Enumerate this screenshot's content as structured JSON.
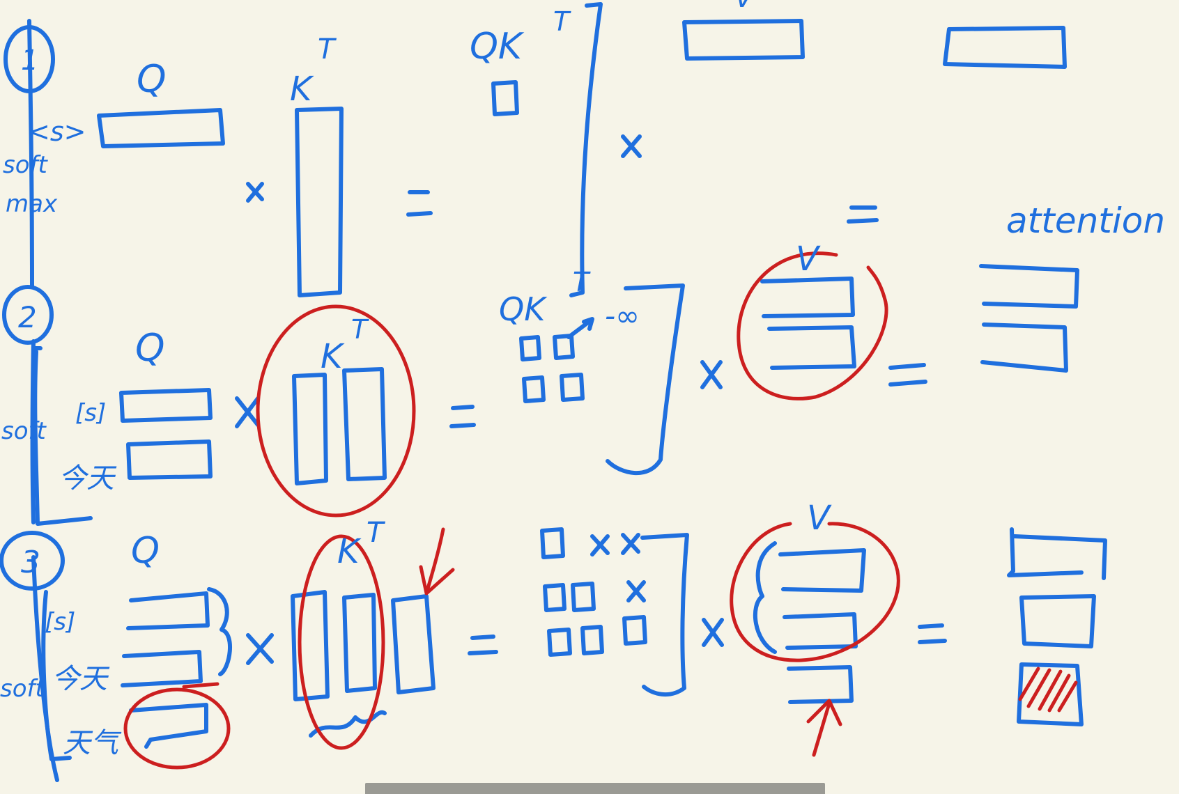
{
  "colors": {
    "background": "#f6f4e8",
    "ink_blue": "#1f6fde",
    "ink_red": "#cc1f1f",
    "scrollbar": "#9a9a94"
  },
  "step_markers": [
    "1",
    "2",
    "3"
  ],
  "left_margin": {
    "step1_token": "<s>",
    "step1_label_1": "soft",
    "step1_label_2": "max",
    "step2_token": "[s]",
    "step2_side": "soft",
    "step2_word": "今天",
    "step3_token": "[s]",
    "step3_side": "soft",
    "step3_word1": "今天",
    "step3_word2": "天气"
  },
  "labels": {
    "q": "Q",
    "kt": "K",
    "kt_sup": "T",
    "qkt": "QK",
    "qkt_sup": "T",
    "v": "V",
    "times": "×",
    "equals": "=",
    "attention": "attention",
    "minus_inf": "-∞",
    "mask_x": "×"
  }
}
